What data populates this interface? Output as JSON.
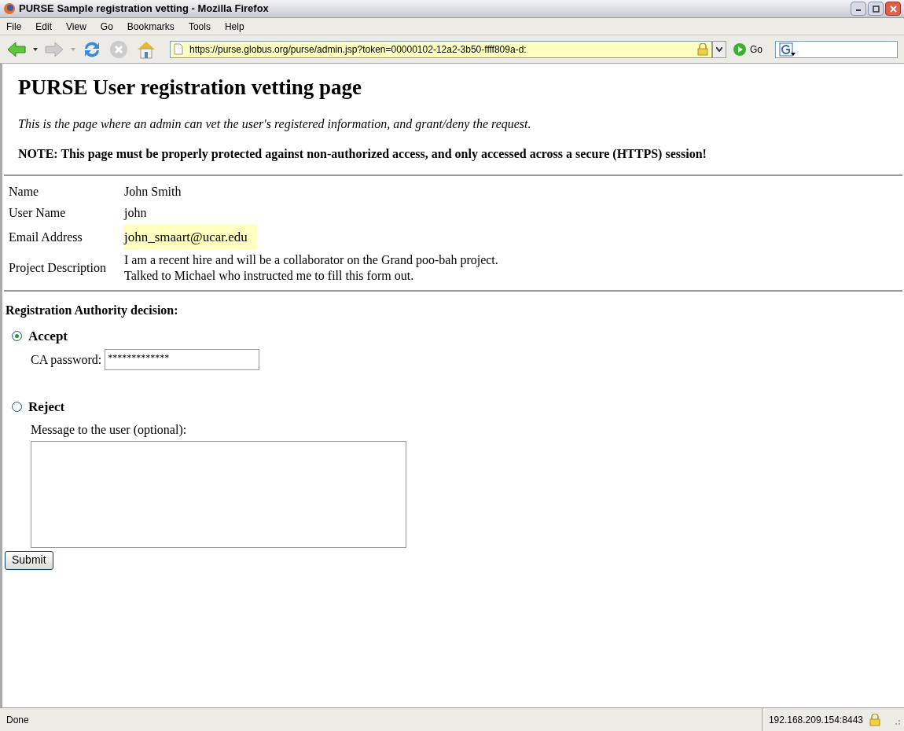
{
  "window": {
    "title": "PURSE Sample registration vetting - Mozilla Firefox"
  },
  "menu": [
    "File",
    "Edit",
    "View",
    "Go",
    "Bookmarks",
    "Tools",
    "Help"
  ],
  "address_bar": {
    "value": "https://purse.globus.org/purse/admin.jsp?token=00000102-12a2-3b50-ffff809a-d:",
    "go_label": "Go"
  },
  "page": {
    "heading": "PURSE User registration vetting page",
    "intro": "This is the page where an admin can vet the user's registered information, and grant/deny the request.",
    "note": "NOTE: This page must be properly protected against non-authorized access, and only accessed across a secure (HTTPS) session!",
    "fields": [
      {
        "label": "Name",
        "value": [
          "John Smith"
        ],
        "highlighted": false
      },
      {
        "label": "User Name",
        "value": [
          "john"
        ],
        "highlighted": false
      },
      {
        "label": "Email Address",
        "value": [
          "john_smaart@ucar.edu"
        ],
        "highlighted": true
      },
      {
        "label": "Project Description",
        "value": [
          "I am a recent hire and will be a collaborator on the Grand poo-bah project.",
          "Talked to Michael who instructed me to fill this form out."
        ],
        "highlighted": false
      }
    ],
    "decision_heading": "Registration Authority decision:",
    "options": [
      {
        "label": "Accept",
        "selected": true,
        "kind": "password",
        "field_label": "CA password:",
        "value": "*************"
      },
      {
        "label": "Reject",
        "selected": false,
        "kind": "message",
        "field_label": "Message to the user (optional):"
      }
    ],
    "submit": "Submit"
  },
  "status_bar": {
    "text": "Done",
    "host": "192.168.209.154:8443"
  }
}
